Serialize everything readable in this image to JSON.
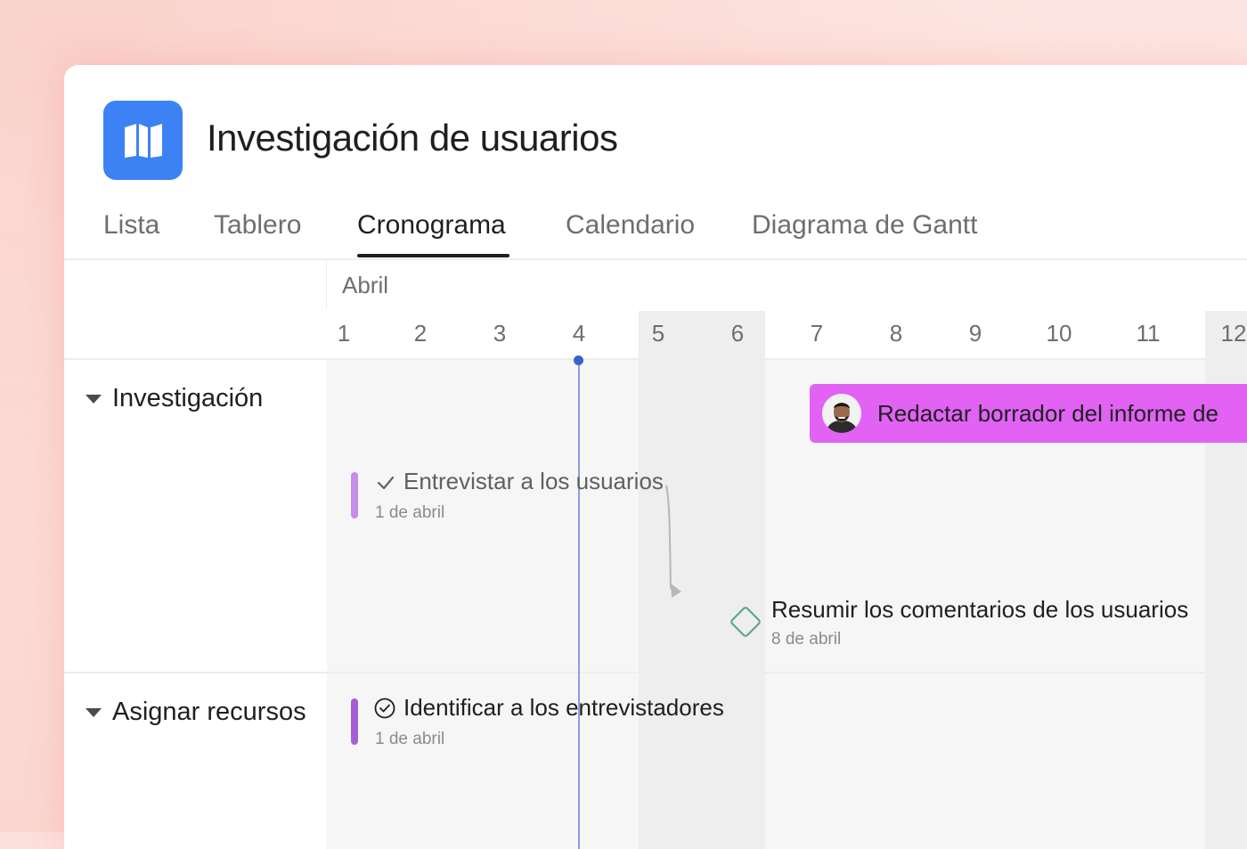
{
  "app": {
    "title": "Investigación de usuarios",
    "icon": "map-icon",
    "accent": "#3d82f5"
  },
  "tabs": [
    {
      "label": "Lista",
      "active": false
    },
    {
      "label": "Tablero",
      "active": false
    },
    {
      "label": "Cronograma",
      "active": true
    },
    {
      "label": "Calendario",
      "active": false
    },
    {
      "label": "Diagrama de Gantt",
      "active": false
    }
  ],
  "timeline": {
    "month": "Abril",
    "days": [
      "1",
      "2",
      "3",
      "4",
      "5",
      "6",
      "7",
      "8",
      "9",
      "10",
      "11",
      "12"
    ],
    "today": "4",
    "weekend_days": [
      "5",
      "6",
      "12"
    ]
  },
  "groups": [
    {
      "name": "Investigación",
      "tasks": [
        {
          "name": "Redactar borrador del informe de",
          "color": "#e162f3",
          "assignee": "avatar"
        },
        {
          "name": "Entrevistar a los usuarios",
          "date": "1 de abril",
          "status": "completed",
          "color": "#c58ee8"
        },
        {
          "name": "Resumir los comentarios de los usuarios",
          "date": "8 de abril",
          "type": "milestone",
          "color": "#5aa88a"
        }
      ]
    },
    {
      "name": "Asignar recursos",
      "tasks": [
        {
          "name": "Identificar a los entrevistadores",
          "date": "1 de abril",
          "status": "incomplete",
          "color": "#a55fd6"
        }
      ]
    }
  ]
}
